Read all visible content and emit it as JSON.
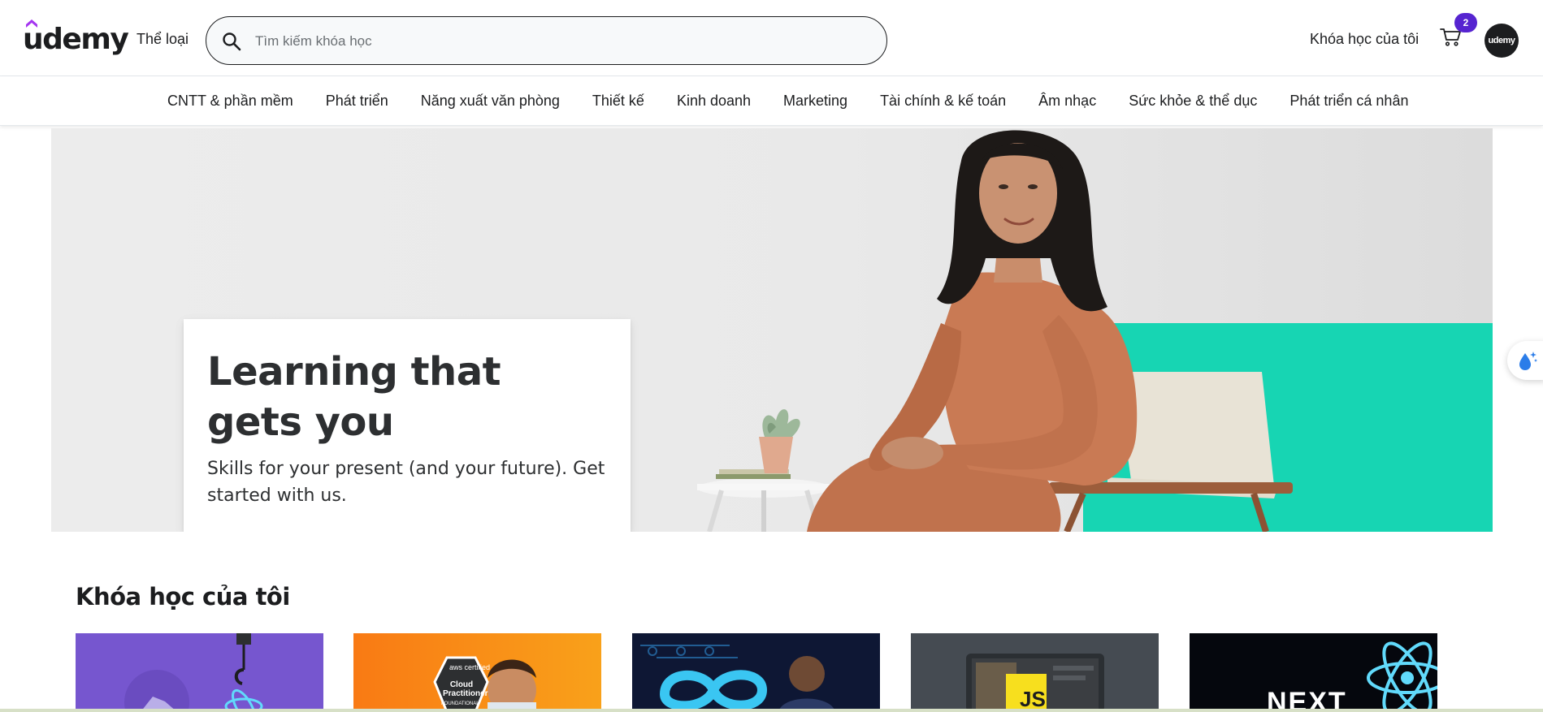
{
  "header": {
    "logo_text": "udemy",
    "categories_label": "Thể loại",
    "search": {
      "placeholder": "Tìm kiếm khóa học",
      "value": ""
    },
    "my_courses_label": "Khóa học của tôi",
    "cart_count": "2",
    "avatar_text": "udemy"
  },
  "categories": [
    "CNTT & phần mềm",
    "Phát triển",
    "Năng xuất văn phòng",
    "Thiết kế",
    "Kinh doanh",
    "Marketing",
    "Tài chính & kế toán",
    "Âm nhạc",
    "Sức khỏe & thể dục",
    "Phát triển cá nhân"
  ],
  "hero": {
    "title": "Learning that gets you",
    "subtitle": "Skills for your present (and your future). Get started with us."
  },
  "my_courses": {
    "title": "Khóa học của tôi",
    "thumbnail_texts": [
      "aws certified",
      "Cloud Practitioner",
      "FOUNDATIONAL",
      "JS",
      "NEXT"
    ]
  },
  "colors": {
    "brand_purple": "#a435f0",
    "badge_purple": "#5624d0",
    "hero_teal": "#17d5b3",
    "text_dark": "#1c1d1f"
  }
}
